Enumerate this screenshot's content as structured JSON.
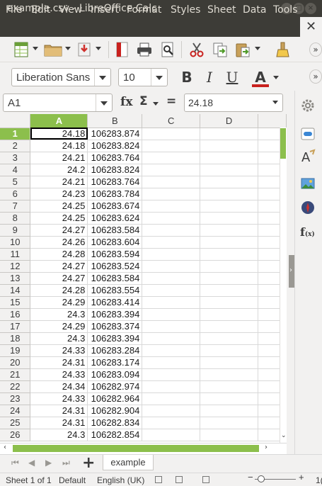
{
  "window": {
    "title": "example.csv - LibreOffice Calc"
  },
  "menu": [
    "File",
    "Edit",
    "View",
    "Insert",
    "Format",
    "Styles",
    "Sheet",
    "Data",
    "Tools"
  ],
  "toolbar": {
    "icons": [
      "new-spreadsheet-icon",
      "open-folder-icon",
      "save-icon",
      "export-pdf-icon",
      "print-icon",
      "print-preview-icon",
      "cut-icon",
      "copy-icon",
      "paste-icon",
      "clone-formatting-icon"
    ]
  },
  "format_toolbar": {
    "font_name": "Liberation Sans",
    "font_size": "10",
    "bold": "B",
    "italic": "I",
    "underline": "U",
    "font_color": "A",
    "font_color_hex": "#c9211e"
  },
  "formula_bar": {
    "name_box": "A1",
    "function_wizard": "fx",
    "sum": "Σ",
    "equals": "=",
    "content": "24.18"
  },
  "sheet": {
    "columns": [
      "A",
      "B",
      "C",
      "D"
    ],
    "active_cell": "A1",
    "rows": [
      {
        "n": "1",
        "a": "24.18",
        "b": "106283.874"
      },
      {
        "n": "2",
        "a": "24.18",
        "b": "106283.824"
      },
      {
        "n": "3",
        "a": "24.21",
        "b": "106283.764"
      },
      {
        "n": "4",
        "a": "24.2",
        "b": "106283.824"
      },
      {
        "n": "5",
        "a": "24.21",
        "b": "106283.764"
      },
      {
        "n": "6",
        "a": "24.23",
        "b": "106283.784"
      },
      {
        "n": "7",
        "a": "24.25",
        "b": "106283.674"
      },
      {
        "n": "8",
        "a": "24.25",
        "b": "106283.624"
      },
      {
        "n": "9",
        "a": "24.27",
        "b": "106283.584"
      },
      {
        "n": "10",
        "a": "24.26",
        "b": "106283.604"
      },
      {
        "n": "11",
        "a": "24.28",
        "b": "106283.594"
      },
      {
        "n": "12",
        "a": "24.27",
        "b": "106283.524"
      },
      {
        "n": "13",
        "a": "24.27",
        "b": "106283.584"
      },
      {
        "n": "14",
        "a": "24.28",
        "b": "106283.554"
      },
      {
        "n": "15",
        "a": "24.29",
        "b": "106283.414"
      },
      {
        "n": "16",
        "a": "24.3",
        "b": "106283.394"
      },
      {
        "n": "17",
        "a": "24.29",
        "b": "106283.374"
      },
      {
        "n": "18",
        "a": "24.3",
        "b": "106283.394"
      },
      {
        "n": "19",
        "a": "24.33",
        "b": "106283.284"
      },
      {
        "n": "20",
        "a": "24.31",
        "b": "106283.174"
      },
      {
        "n": "21",
        "a": "24.33",
        "b": "106283.094"
      },
      {
        "n": "22",
        "a": "24.34",
        "b": "106282.974"
      },
      {
        "n": "23",
        "a": "24.33",
        "b": "106282.964"
      },
      {
        "n": "24",
        "a": "24.31",
        "b": "106282.904"
      },
      {
        "n": "25",
        "a": "24.31",
        "b": "106282.834"
      },
      {
        "n": "26",
        "a": "24.3",
        "b": "106282.854"
      }
    ]
  },
  "tabs": {
    "add": "+",
    "sheet_name": "example"
  },
  "status": {
    "sheet": "Sheet 1 of 1",
    "page_style": "Default",
    "language": "English (UK)",
    "zoom_percent": "1("
  },
  "colors": {
    "accent": "#8cbf4c",
    "titlebar": "#3d3c37"
  }
}
